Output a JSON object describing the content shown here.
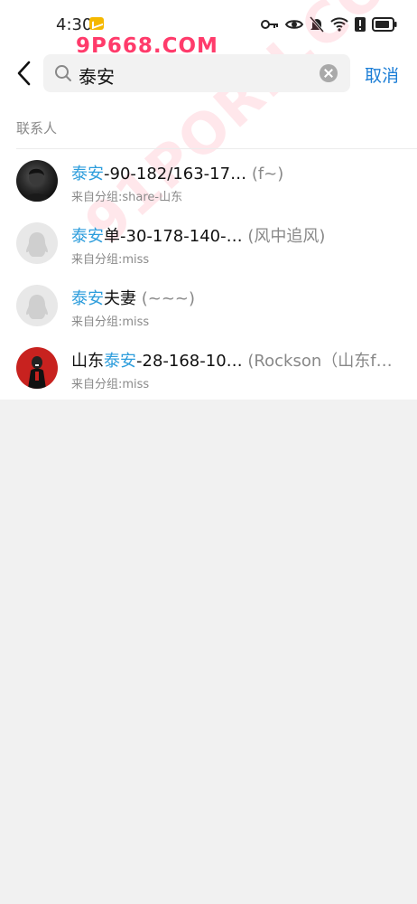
{
  "status_bar": {
    "time": "4:30",
    "icons": [
      "mail-notification-icon",
      "key-icon",
      "eye-icon",
      "mute-icon",
      "wifi-icon",
      "alert-icon",
      "battery-icon"
    ]
  },
  "watermark": {
    "text": "9P668.COM",
    "diagonal_text": "91PORN.COM"
  },
  "search": {
    "query": "泰安",
    "cancel_label": "取消"
  },
  "section": {
    "label": "联系人"
  },
  "highlight_color": "#2d9ddc",
  "contacts": [
    {
      "prefix": "",
      "match": "泰安",
      "suffix": "-90-182/163-17…",
      "nickname": "(f~)",
      "group": "来自分组:share-山东",
      "avatar": "photo"
    },
    {
      "prefix": "",
      "match": "泰安",
      "suffix": "单-30-178-140-…",
      "nickname": "(风中追风)",
      "group": "来自分组:miss",
      "avatar": "default-penguin"
    },
    {
      "prefix": "",
      "match": "泰安",
      "suffix": "夫妻",
      "nickname": "(~~~)",
      "group": "来自分组:miss",
      "avatar": "default-penguin"
    },
    {
      "prefix": "山东",
      "match": "泰安",
      "suffix": "-28-168-10…",
      "nickname": "(Rockson（山东f…",
      "group": "来自分组:miss",
      "avatar": "photo"
    }
  ]
}
